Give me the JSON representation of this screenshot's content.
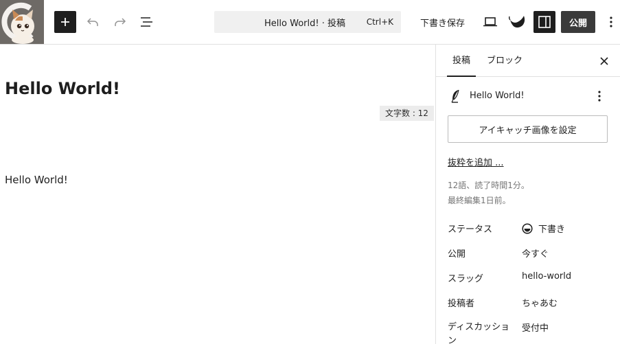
{
  "toolbar": {
    "command_title": "Hello World! · 投稿",
    "command_shortcut": "Ctrl+K",
    "save_draft_label": "下書き保存",
    "publish_label": "公開",
    "icons": [
      "site-logo",
      "plus-icon",
      "undo-icon",
      "redo-icon",
      "list-view-icon",
      "desktop-preview-icon",
      "jetpack-icon",
      "sidebar-toggle-icon",
      "more-vertical-icon"
    ]
  },
  "editor": {
    "post_title": "Hello World!",
    "word_count_badge": "文字数 : 12",
    "paragraph": "Hello World!"
  },
  "sidebar": {
    "tabs": [
      {
        "label": "投稿",
        "active": true
      },
      {
        "label": "ブロック",
        "active": false
      }
    ],
    "post_card_title": "Hello World!",
    "featured_image_button": "アイキャッチ画像を設定",
    "excerpt_link": "抜粋を追加 ...",
    "meta_line1": "12語、読了時間1分。",
    "meta_line2": "最終編集1日前。",
    "rows": [
      {
        "label": "ステータス",
        "value": "下書き"
      },
      {
        "label": "公開",
        "value": "今すぐ"
      },
      {
        "label": "スラッグ",
        "value": "hello-world"
      },
      {
        "label": "投稿者",
        "value": "ちゃあむ"
      },
      {
        "label": "ディスカッション",
        "value": "受付中"
      }
    ]
  },
  "colors": {
    "dark": "#1e1e1e",
    "publish_bg": "#3a3a3a",
    "command_bar_bg": "#f0f0f0",
    "muted_text": "#757575",
    "border": "#e0e0e0"
  }
}
